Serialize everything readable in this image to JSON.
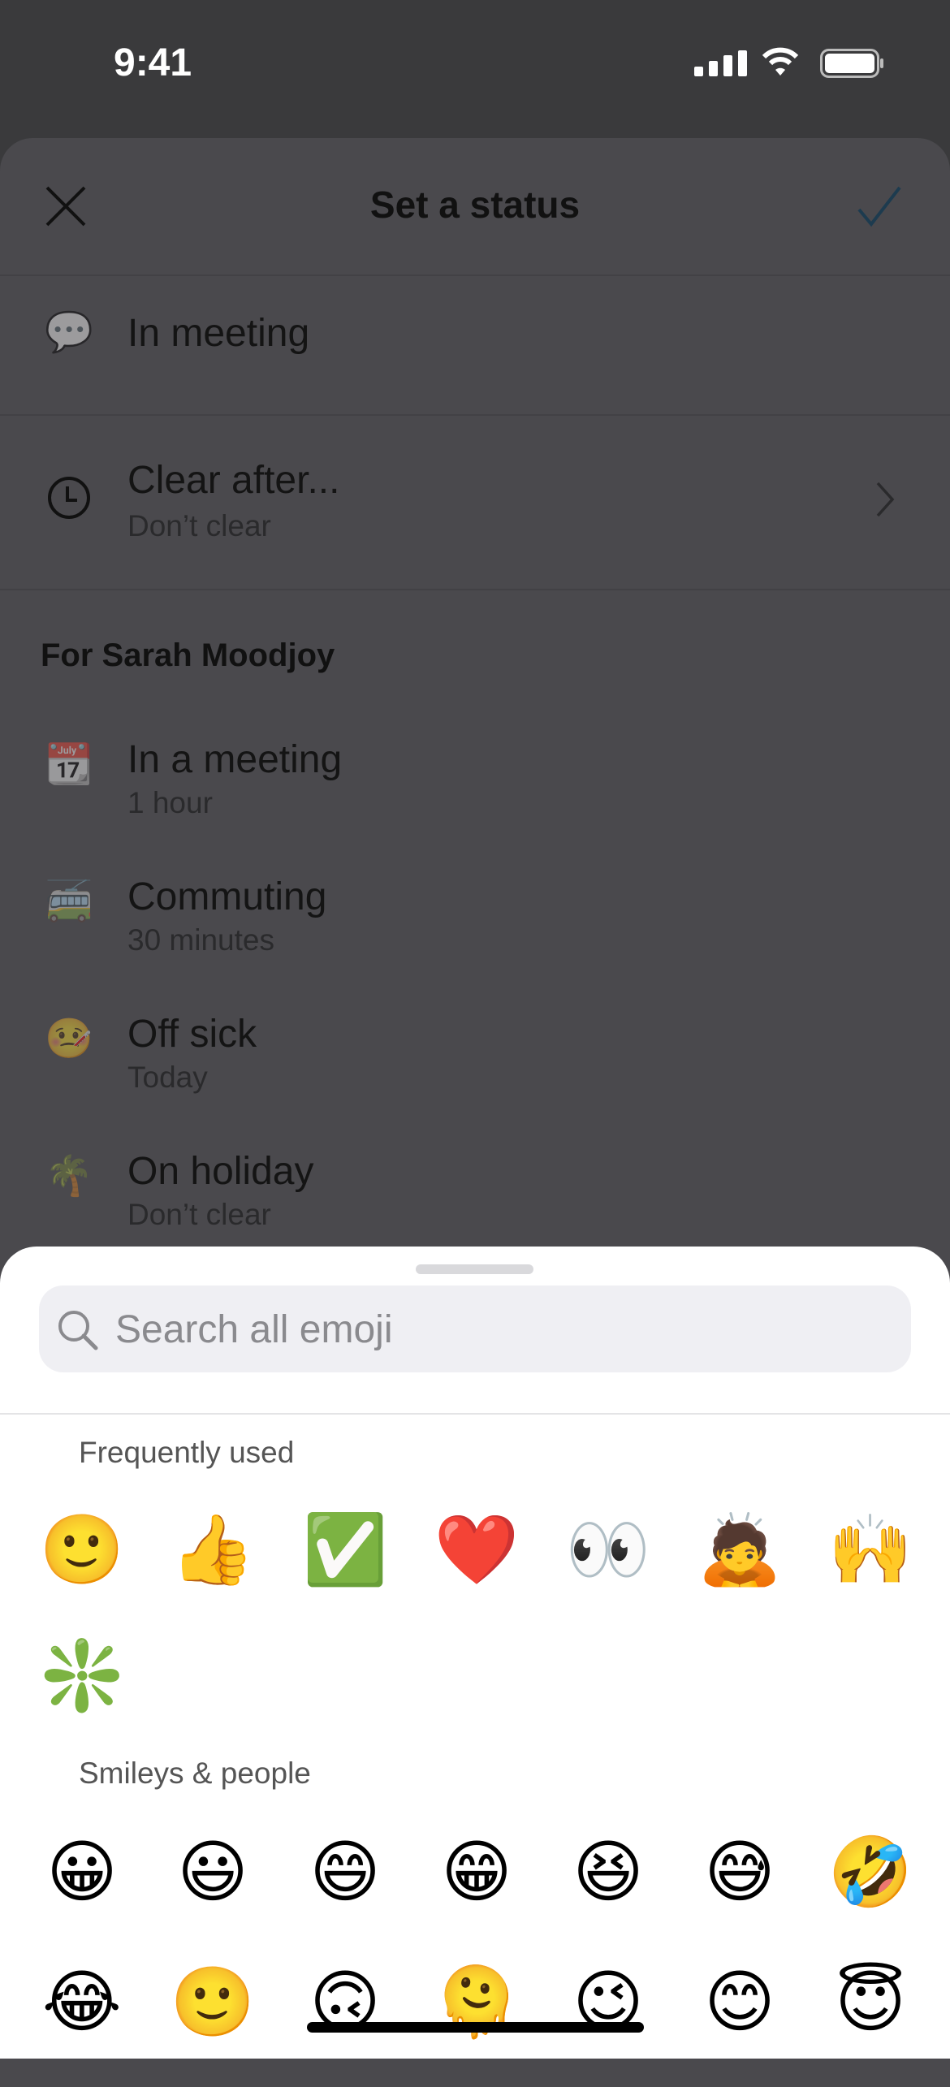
{
  "status_bar": {
    "time": "9:41"
  },
  "header": {
    "title": "Set a status",
    "close_icon": "close-icon",
    "confirm_icon": "checkmark-icon"
  },
  "current_status": {
    "emoji": "💬",
    "text": "In meeting"
  },
  "clear_after": {
    "title": "Clear after...",
    "value": "Don’t clear"
  },
  "presets": {
    "heading": "For Sarah Moodjoy",
    "items": [
      {
        "emoji": "📆",
        "title": "In a meeting",
        "duration": "1 hour"
      },
      {
        "emoji": "🚎",
        "title": "Commuting",
        "duration": "30 minutes"
      },
      {
        "emoji": "🤒",
        "title": "Off sick",
        "duration": "Today"
      },
      {
        "emoji": "🌴",
        "title": "On holiday",
        "duration": "Don’t clear"
      }
    ]
  },
  "emoji_picker": {
    "search_placeholder": "Search all emoji",
    "frequently_used": {
      "label": "Frequently used",
      "emojis": [
        "🙂",
        "👍",
        "✅",
        "❤️",
        "👀",
        "🙇",
        "🙌",
        "❇️"
      ]
    },
    "smileys": {
      "label": "Smileys & people",
      "emojis": [
        "😀",
        "😃",
        "😄",
        "😁",
        "😆",
        "😅",
        "🤣",
        "😂",
        "🙂",
        "🙃",
        "🫠",
        "😉",
        "😊",
        "😇"
      ]
    }
  },
  "colors": {
    "accent": "#1d3b4f",
    "overlay": "#4a494d",
    "picker_bg": "#ffffff"
  }
}
